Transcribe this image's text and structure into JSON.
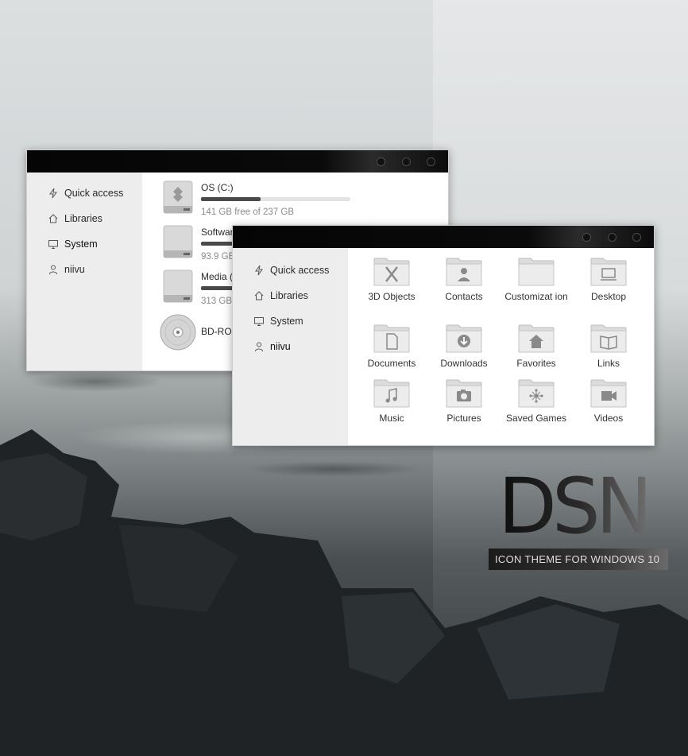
{
  "nav_items": [
    {
      "label": "Quick access",
      "icon": "lightning-icon"
    },
    {
      "label": "Libraries",
      "icon": "home-icon"
    },
    {
      "label": "System",
      "icon": "monitor-icon"
    },
    {
      "label": "niivu",
      "icon": "user-icon"
    }
  ],
  "drives": [
    {
      "name": "OS (C:)",
      "free": "141 GB free of 237 GB",
      "used_fraction": 0.4,
      "icon": "windows-drive-icon"
    },
    {
      "name": "Softwar",
      "free": "93.9 GB",
      "used_fraction": 0.5,
      "icon": "hard-drive-icon"
    },
    {
      "name": "Media (",
      "free": "313 GB",
      "used_fraction": 0.5,
      "icon": "hard-drive-icon"
    },
    {
      "name": "BD-RON",
      "icon": "disc-icon"
    }
  ],
  "folders": [
    {
      "label": "3D Objects",
      "icon": "3d-objects-icon"
    },
    {
      "label": "Contacts",
      "icon": "contacts-icon"
    },
    {
      "label": "Customizat ion",
      "icon": "customization-icon"
    },
    {
      "label": "Desktop",
      "icon": "desktop-icon"
    },
    {
      "label": "Documents",
      "icon": "documents-icon"
    },
    {
      "label": "Downloads",
      "icon": "downloads-icon"
    },
    {
      "label": "Favorites",
      "icon": "favorites-icon"
    },
    {
      "label": "Links",
      "icon": "links-icon"
    },
    {
      "label": "Music",
      "icon": "music-icon"
    },
    {
      "label": "Pictures",
      "icon": "pictures-icon"
    },
    {
      "label": "Saved Games",
      "icon": "saved-games-icon"
    },
    {
      "label": "Videos",
      "icon": "videos-icon"
    }
  ],
  "branding": {
    "logo": "DSN",
    "tagline": "ICON THEME FOR WINDOWS 10"
  }
}
